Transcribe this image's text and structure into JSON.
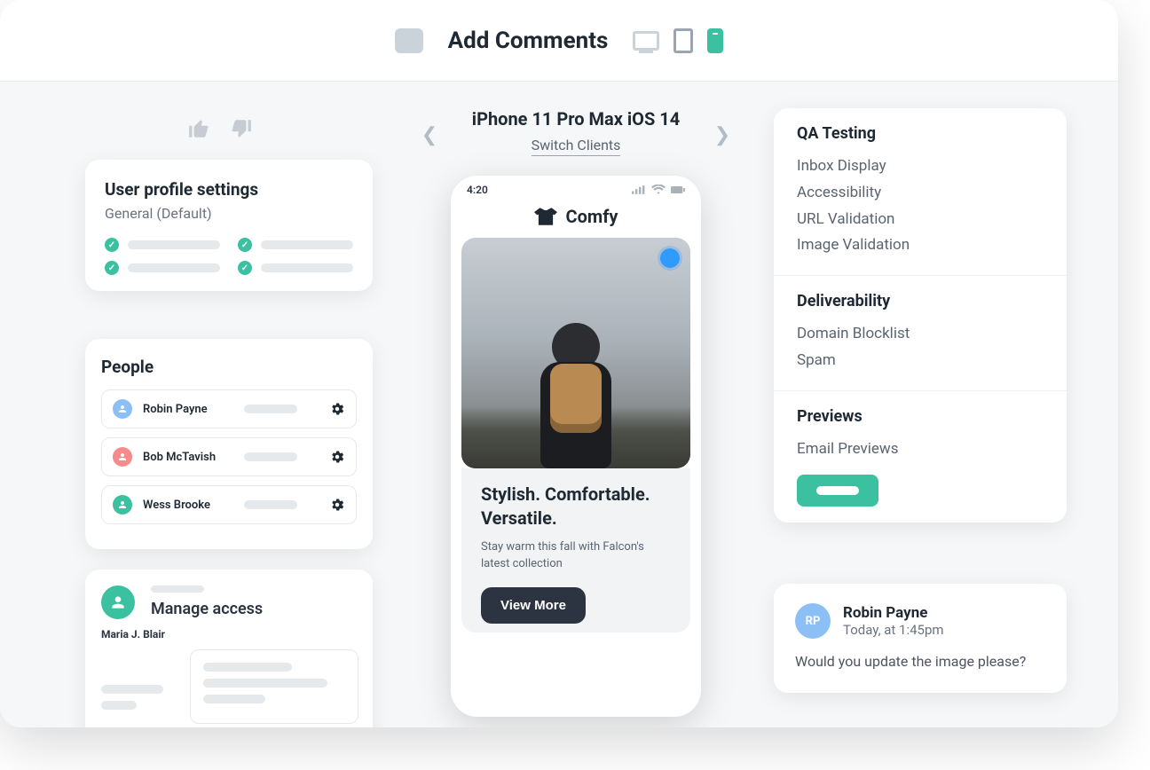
{
  "header": {
    "title": "Add Comments"
  },
  "center": {
    "device_label": "iPhone 11 Pro Max iOS 14",
    "switch_label": "Switch Clients",
    "status_time": "4:20",
    "brand": "Comfy",
    "hero_heading": "Stylish. Comfortable. Versatile.",
    "hero_sub": "Stay warm this fall with Falcon's latest collection",
    "cta": "View More"
  },
  "left": {
    "settings": {
      "title": "User profile settings",
      "subtitle": "General (Default)"
    },
    "people": {
      "title": "People",
      "rows": [
        {
          "name": "Robin Payne",
          "color": "av-blue"
        },
        {
          "name": "Bob McTavish",
          "color": "av-red"
        },
        {
          "name": "Wess Brooke",
          "color": "av-green"
        }
      ]
    },
    "access": {
      "title": "Manage access",
      "owner": "Maria J. Blair"
    }
  },
  "right": {
    "qa": {
      "section1_title": "QA Testing",
      "section1_items": [
        "Inbox Display",
        "Accessibility",
        "URL Validation",
        "Image Validation"
      ],
      "section2_title": "Deliverability",
      "section2_items": [
        "Domain Blocklist",
        "Spam"
      ],
      "section3_title": "Previews",
      "section3_items": [
        "Email Previews"
      ]
    },
    "comment": {
      "initials": "RP",
      "name": "Robin Payne",
      "time": "Today, at 1:45pm",
      "body": "Would you update the image please?"
    }
  }
}
